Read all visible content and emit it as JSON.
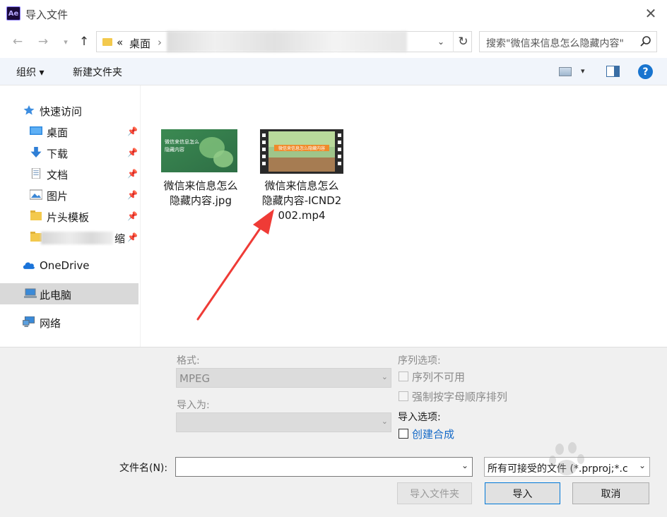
{
  "window": {
    "title": "导入文件",
    "app_icon_text": "Ae"
  },
  "nav": {
    "breadcrumb_prefix": "«",
    "breadcrumb_desktop": "桌面",
    "breadcrumb_sep": "›",
    "search_placeholder": "搜索\"微信来信息怎么隐藏内容\""
  },
  "toolbar": {
    "organize": "组织 ▾",
    "new_folder": "新建文件夹"
  },
  "sidebar": {
    "items": [
      {
        "label": "快速访问",
        "icon": "star-icon"
      },
      {
        "label": "桌面",
        "icon": "desktop-icon",
        "pinned": true
      },
      {
        "label": "下载",
        "icon": "download-icon",
        "pinned": true
      },
      {
        "label": "文档",
        "icon": "document-icon",
        "pinned": true
      },
      {
        "label": "图片",
        "icon": "picture-icon",
        "pinned": true
      },
      {
        "label": "片头模板",
        "icon": "folder-icon",
        "pinned": true
      },
      {
        "label": "缩",
        "icon": "folder-icon",
        "pinned": true
      },
      {
        "label": "OneDrive",
        "icon": "cloud-icon"
      },
      {
        "label": "此电脑",
        "icon": "computer-icon",
        "selected": true
      },
      {
        "label": "网络",
        "icon": "network-icon"
      }
    ]
  },
  "files": [
    {
      "name": "微信来信息怎么隐藏内容.jpg",
      "thumb_title": "微信来信息怎么\n隐藏内容",
      "kind": "image"
    },
    {
      "name": "微信来信息怎么隐藏内容-ICND2002.mp4",
      "thumb_title": "微信来信息怎么隐藏内容",
      "kind": "video"
    }
  ],
  "options": {
    "format_label": "格式:",
    "format_value": "MPEG",
    "import_as_label": "导入为:",
    "import_as_value": "",
    "sequence_label": "序列选项:",
    "sequence_unavailable": "序列不可用",
    "force_alpha": "强制按字母顺序排列",
    "import_options_label": "导入选项:",
    "create_comp": "创建合成"
  },
  "footer": {
    "filename_label": "文件名(N):",
    "filename_value": "",
    "filetype_value": "所有可接受的文件 (*.prproj;*.c",
    "import_folder_btn": "导入文件夹",
    "import_btn": "导入",
    "cancel_btn": "取消"
  },
  "colors": {
    "accent": "#0078d7",
    "link": "#1469c7",
    "arrow": "#ef3b36",
    "selected_bg": "#d9d9d9"
  }
}
